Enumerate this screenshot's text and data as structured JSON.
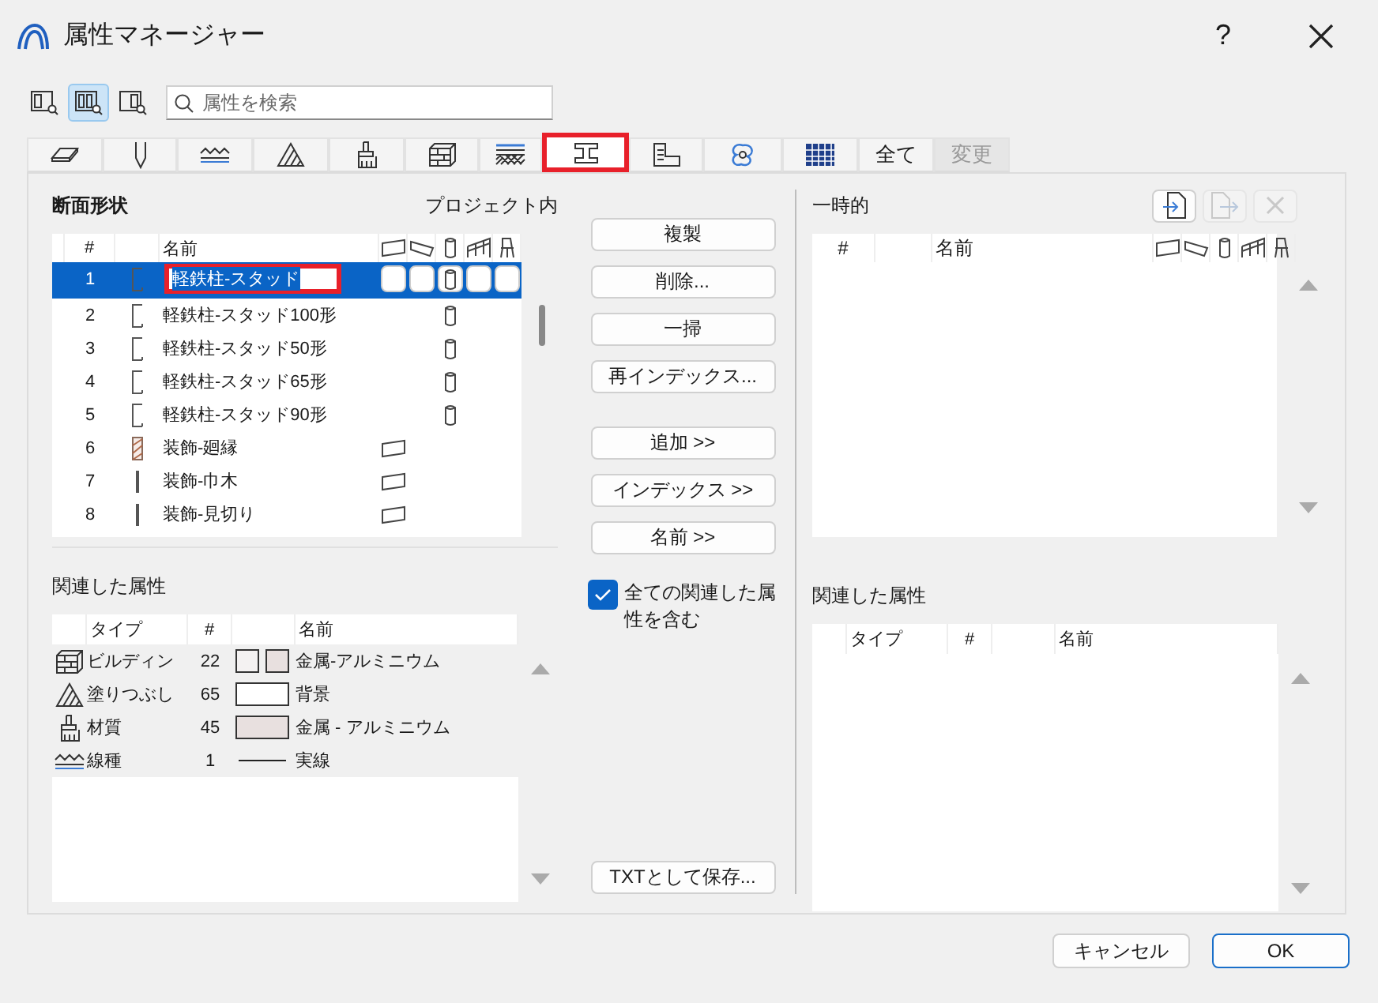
{
  "window": {
    "title": "属性マネージャー",
    "help": "?"
  },
  "view_buttons": [
    {
      "selected": false
    },
    {
      "selected": true
    },
    {
      "selected": false
    }
  ],
  "search": {
    "placeholder": "属性を検索"
  },
  "tabs": [
    {
      "kind": "icon",
      "selected": false,
      "highlighted": false
    },
    {
      "kind": "icon",
      "selected": false,
      "highlighted": false
    },
    {
      "kind": "icon",
      "selected": false,
      "highlighted": false
    },
    {
      "kind": "icon",
      "selected": false,
      "highlighted": false
    },
    {
      "kind": "icon",
      "selected": false,
      "highlighted": false
    },
    {
      "kind": "icon",
      "selected": false,
      "highlighted": false
    },
    {
      "kind": "icon",
      "selected": false,
      "highlighted": false
    },
    {
      "kind": "icon",
      "selected": true,
      "highlighted": true
    },
    {
      "kind": "icon",
      "selected": false,
      "highlighted": false
    },
    {
      "kind": "icon",
      "selected": false,
      "highlighted": false
    },
    {
      "kind": "icon",
      "selected": false,
      "highlighted": false
    },
    {
      "kind": "text",
      "label": "全て",
      "selected": false,
      "disabled": false
    },
    {
      "kind": "text",
      "label": "変更",
      "selected": false,
      "disabled": true
    }
  ],
  "left": {
    "title": "断面形状",
    "scope": "プロジェクト内",
    "header_number": "#",
    "header_name": "名前",
    "rows": [
      {
        "number": "1",
        "name": "軽鉄柱-スタッド",
        "kind": "stud",
        "uses": [
          false,
          false,
          true,
          false,
          false
        ],
        "selected": true,
        "highlighted": true
      },
      {
        "number": "2",
        "name": "軽鉄柱-スタッド100形",
        "kind": "stud",
        "uses": [
          false,
          false,
          true,
          false,
          false
        ],
        "selected": false,
        "highlighted": false
      },
      {
        "number": "3",
        "name": "軽鉄柱-スタッド50形",
        "kind": "stud",
        "uses": [
          false,
          false,
          true,
          false,
          false
        ],
        "selected": false,
        "highlighted": false
      },
      {
        "number": "4",
        "name": "軽鉄柱-スタッド65形",
        "kind": "stud",
        "uses": [
          false,
          false,
          true,
          false,
          false
        ],
        "selected": false,
        "highlighted": false
      },
      {
        "number": "5",
        "name": "軽鉄柱-スタッド90形",
        "kind": "stud",
        "uses": [
          false,
          false,
          true,
          false,
          false
        ],
        "selected": false,
        "highlighted": false
      },
      {
        "number": "6",
        "name": "装飾-廻縁",
        "kind": "hatched",
        "uses": [
          true,
          false,
          false,
          false,
          false
        ],
        "selected": false,
        "highlighted": false
      },
      {
        "number": "7",
        "name": "装飾-巾木",
        "kind": "bar",
        "uses": [
          true,
          false,
          false,
          false,
          false
        ],
        "selected": false,
        "highlighted": false
      },
      {
        "number": "8",
        "name": "装飾-見切り",
        "kind": "bar",
        "uses": [
          true,
          false,
          false,
          false,
          false
        ],
        "selected": false,
        "highlighted": false
      }
    ]
  },
  "edit_buttons": [
    {
      "label": "複製"
    },
    {
      "label": "削除..."
    },
    {
      "label": "一掃"
    },
    {
      "label": "再インデックス..."
    }
  ],
  "transfer_buttons": [
    {
      "label": "追加 >>"
    },
    {
      "label": "インデックス >>"
    },
    {
      "label": "名前 >>"
    }
  ],
  "include_related": {
    "label": "全ての関連した属性を含む",
    "checked": true
  },
  "save_button": {
    "label": "TXTとして保存..."
  },
  "right": {
    "title": "一時的",
    "header_number": "#",
    "header_name": "名前",
    "tools": [
      {
        "disabled": false
      },
      {
        "disabled": true
      },
      {
        "disabled": true
      }
    ]
  },
  "related_left": {
    "title": "関連した属性",
    "header_type": "タイプ",
    "header_number": "#",
    "header_name": "名前",
    "rows": [
      {
        "kind": "brick",
        "type": "ビルディン",
        "number": "22",
        "swatch": {
          "kind": "pair"
        },
        "name": "金属-アルミニウム"
      },
      {
        "kind": "fill",
        "type": "塗りつぶし",
        "number": "65",
        "swatch": {
          "kind": "blank"
        },
        "name": "背景"
      },
      {
        "kind": "brush",
        "type": "材質",
        "number": "45",
        "swatch": {
          "kind": "tinted"
        },
        "name": "金属 - アルミニウム"
      },
      {
        "kind": "line",
        "type": "線種",
        "number": "1",
        "swatch": {
          "kind": "line"
        },
        "name": "実線"
      }
    ]
  },
  "related_right": {
    "title": "関連した属性",
    "header_type": "タイプ",
    "header_number": "#",
    "header_name": "名前"
  },
  "footer": {
    "buttons": [
      {
        "label": "キャンセル",
        "default": false
      },
      {
        "label": "OK",
        "default": true
      }
    ]
  }
}
